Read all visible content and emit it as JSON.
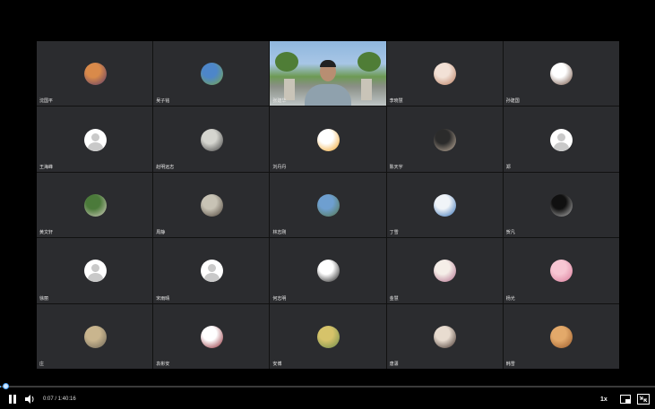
{
  "participants": [
    {
      "name": "沈国平",
      "avatar": "sunset-photo",
      "color1": "#d98a4a",
      "color2": "#5b3a6a"
    },
    {
      "name": "吴子铭",
      "avatar": "sky-photo",
      "color1": "#4d86c9",
      "color2": "#7aa84a"
    },
    {
      "name": "张建华",
      "video": true
    },
    {
      "name": "李晓慧",
      "avatar": "woman-photo",
      "color1": "#f2e1d6",
      "color2": "#b87a5c"
    },
    {
      "name": "孙建国",
      "avatar": "man-photo",
      "color1": "#ffffff",
      "color2": "#6b4a3a"
    },
    {
      "name": "王海峰",
      "avatar": "default"
    },
    {
      "name": "赵明远志",
      "avatar": "calligraphy",
      "color1": "#d5d5cf",
      "color2": "#3b3b3b"
    },
    {
      "name": "刘丹丹",
      "avatar": "cartoon-cat",
      "color1": "#ffffff",
      "color2": "#f0a020"
    },
    {
      "name": "陈天宇",
      "avatar": "dark-photo",
      "color1": "#2b2b2b",
      "color2": "#c9b7a4"
    },
    {
      "name": "郑",
      "avatar": "default"
    },
    {
      "name": "黄文轩",
      "avatar": "plant-photo",
      "color1": "#4b7a3a",
      "color2": "#d6d1c2"
    },
    {
      "name": "周静",
      "avatar": "person-photo",
      "color1": "#c8c3b5",
      "color2": "#4a4036"
    },
    {
      "name": "林志刚",
      "avatar": "landscape-photo",
      "color1": "#6e9fd0",
      "color2": "#55774a"
    },
    {
      "name": "丁雪",
      "avatar": "wave-logo",
      "color1": "#f0f4f8",
      "color2": "#2e6bb3"
    },
    {
      "name": "贺凡",
      "avatar": "moon-photo",
      "color1": "#101010",
      "color2": "#bbbbbb"
    },
    {
      "name": "徐丽",
      "avatar": "default"
    },
    {
      "name": "宋雨晴",
      "avatar": "default"
    },
    {
      "name": "何志明",
      "avatar": "sketch-logo",
      "color1": "#ffffff",
      "color2": "#111111"
    },
    {
      "name": "金慧",
      "avatar": "seal-pink",
      "color1": "#f5eee8",
      "color2": "#b06a8a"
    },
    {
      "name": "杨光",
      "avatar": "flower-photo",
      "color1": "#f7c6d3",
      "color2": "#d97a99"
    },
    {
      "name": "庄",
      "avatar": "rock-photo",
      "color1": "#c9b58e",
      "color2": "#6b6456"
    },
    {
      "name": "袁彬安",
      "avatar": "university-seal",
      "color1": "#ffffff",
      "color2": "#8a1f2a"
    },
    {
      "name": "安博",
      "avatar": "group-photo",
      "color1": "#d6c36a",
      "color2": "#6a8a4a"
    },
    {
      "name": "唐潇",
      "avatar": "girl-photo",
      "color1": "#e8dcd0",
      "color2": "#3a2a24"
    },
    {
      "name": "韩雪",
      "avatar": "food-photo",
      "color1": "#e3a96a",
      "color2": "#9a5a2a"
    }
  ],
  "controls": {
    "time_display": "0:07 / 1:40:16",
    "playback_rate": "1x",
    "progress_fraction": 0.0012
  },
  "colors": {
    "accent": "#4aa3ff",
    "tile_bg": "#2b2c2f",
    "page_bg": "#000000"
  },
  "icons": {
    "play_pause": "pause-icon",
    "volume": "volume-icon",
    "pip": "picture-in-picture-icon",
    "fullscreen": "exit-fullscreen-icon"
  }
}
